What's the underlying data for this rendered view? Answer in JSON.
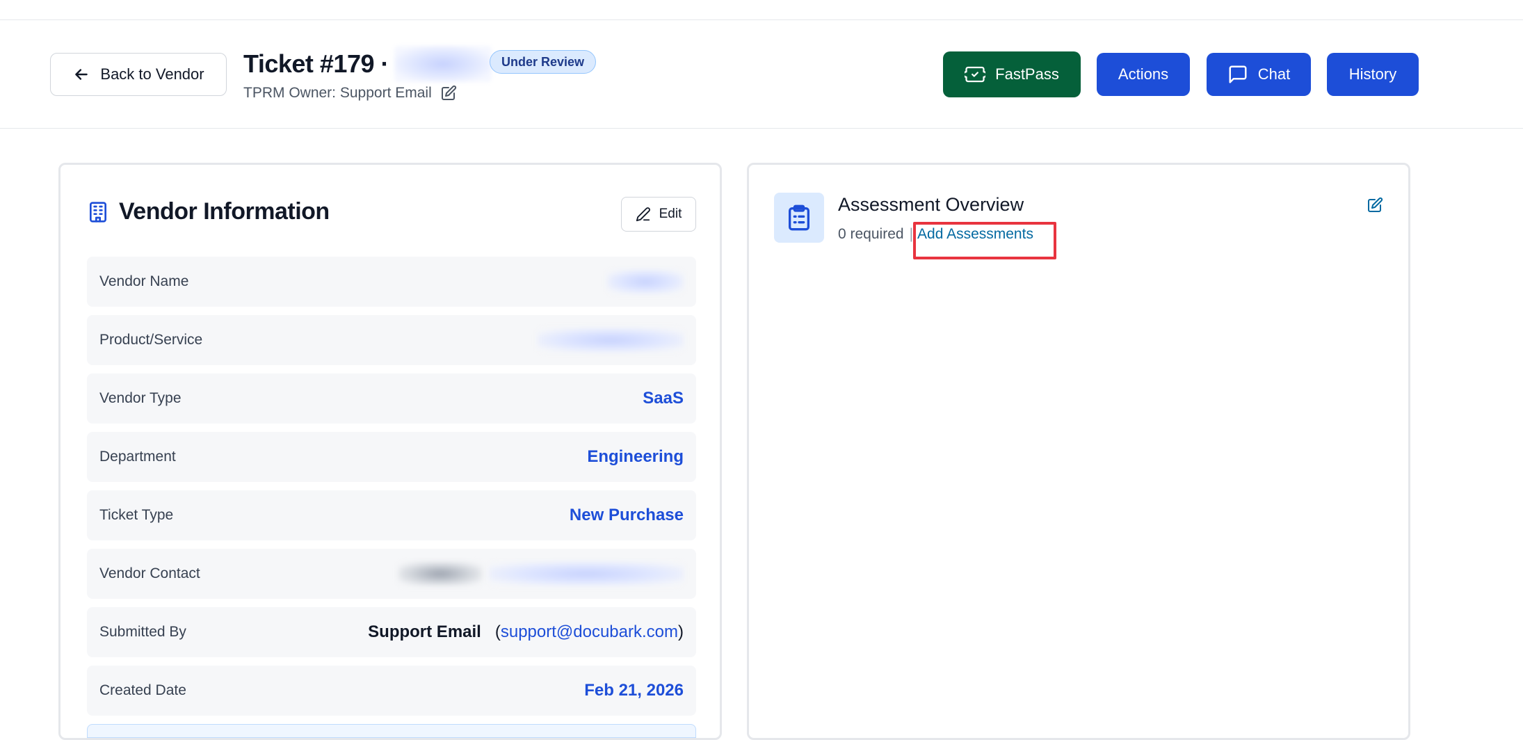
{
  "header": {
    "back_label": "Back to Vendor",
    "ticket_title": "Ticket #179 ·",
    "status": "Under Review",
    "owner": "TPRM Owner: Support Email",
    "buttons": {
      "fastpass": "FastPass",
      "actions": "Actions",
      "chat": "Chat",
      "history": "History"
    },
    "colors": {
      "fastpass": "#05603a",
      "primary": "#1d4ed8"
    }
  },
  "vendor_info": {
    "title": "Vendor Information",
    "edit_label": "Edit",
    "rows": [
      {
        "label": "Vendor Name",
        "value": ""
      },
      {
        "label": "Product/Service",
        "value": ""
      },
      {
        "label": "Vendor Type",
        "value": "SaaS"
      },
      {
        "label": "Department",
        "value": "Engineering"
      },
      {
        "label": "Ticket Type",
        "value": "New Purchase"
      },
      {
        "label": "Vendor Contact",
        "value": ""
      },
      {
        "label": "Submitted By",
        "name": "Support Email",
        "email": "support@docubark.com"
      },
      {
        "label": "Created Date",
        "value": "Feb 21, 2026"
      }
    ]
  },
  "assessment": {
    "title": "Assessment Overview",
    "required": "0 required",
    "separator": "|",
    "link": "Add Assessments"
  },
  "icons": [
    "arrow-left-icon",
    "pencil-square-icon",
    "ticket-check-icon",
    "chat-bubble-icon",
    "building-icon",
    "pencil-icon",
    "clipboard-list-icon"
  ]
}
